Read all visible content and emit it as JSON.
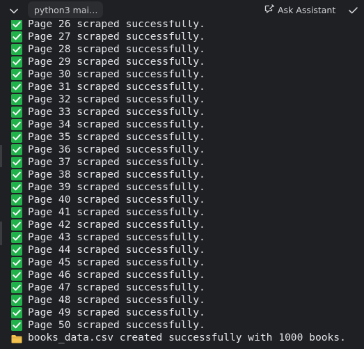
{
  "colors": {
    "background": "#1f2023",
    "text": "#e4e5e8",
    "check_green": "#22b24c",
    "folder_yellow": "#f2c14e"
  },
  "toolbar": {
    "session_tab_label": "python3 mai…",
    "ask_assistant_label": "Ask Assistant",
    "collapse_icon": "chevron-down-icon",
    "assistant_icon": "chat-edit-icon",
    "accept_icon": "check-icon"
  },
  "output": {
    "lines": [
      {
        "icon": "check-mark-icon",
        "text": "Page 26 scraped successfully."
      },
      {
        "icon": "check-mark-icon",
        "text": "Page 27 scraped successfully."
      },
      {
        "icon": "check-mark-icon",
        "text": "Page 28 scraped successfully."
      },
      {
        "icon": "check-mark-icon",
        "text": "Page 29 scraped successfully."
      },
      {
        "icon": "check-mark-icon",
        "text": "Page 30 scraped successfully."
      },
      {
        "icon": "check-mark-icon",
        "text": "Page 31 scraped successfully."
      },
      {
        "icon": "check-mark-icon",
        "text": "Page 32 scraped successfully."
      },
      {
        "icon": "check-mark-icon",
        "text": "Page 33 scraped successfully."
      },
      {
        "icon": "check-mark-icon",
        "text": "Page 34 scraped successfully."
      },
      {
        "icon": "check-mark-icon",
        "text": "Page 35 scraped successfully."
      },
      {
        "icon": "check-mark-icon",
        "text": "Page 36 scraped successfully."
      },
      {
        "icon": "check-mark-icon",
        "text": "Page 37 scraped successfully."
      },
      {
        "icon": "check-mark-icon",
        "text": "Page 38 scraped successfully."
      },
      {
        "icon": "check-mark-icon",
        "text": "Page 39 scraped successfully."
      },
      {
        "icon": "check-mark-icon",
        "text": "Page 40 scraped successfully."
      },
      {
        "icon": "check-mark-icon",
        "text": "Page 41 scraped successfully."
      },
      {
        "icon": "check-mark-icon",
        "text": "Page 42 scraped successfully."
      },
      {
        "icon": "check-mark-icon",
        "text": "Page 43 scraped successfully."
      },
      {
        "icon": "check-mark-icon",
        "text": "Page 44 scraped successfully."
      },
      {
        "icon": "check-mark-icon",
        "text": "Page 45 scraped successfully."
      },
      {
        "icon": "check-mark-icon",
        "text": "Page 46 scraped successfully."
      },
      {
        "icon": "check-mark-icon",
        "text": "Page 47 scraped successfully."
      },
      {
        "icon": "check-mark-icon",
        "text": "Page 48 scraped successfully."
      },
      {
        "icon": "check-mark-icon",
        "text": "Page 49 scraped successfully."
      },
      {
        "icon": "check-mark-icon",
        "text": "Page 50 scraped successfully."
      },
      {
        "icon": "folder-icon",
        "text": "books_data.csv created successfully with 1000 books."
      }
    ]
  }
}
